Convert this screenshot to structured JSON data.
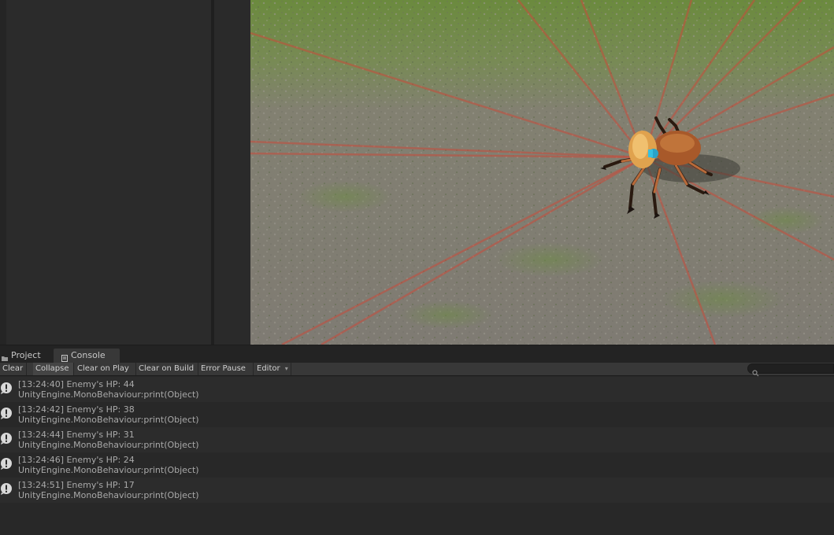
{
  "tabs": {
    "project_label": "Project",
    "console_label": "Console"
  },
  "toolbar": {
    "clear": "Clear",
    "collapse": "Collapse",
    "clear_on_play": "Clear on Play",
    "clear_on_build": "Clear on Build",
    "error_pause": "Error Pause",
    "editor": "Editor",
    "editor_arrow": "▾",
    "search_value": ""
  },
  "console": {
    "entries": [
      {
        "line1": "[13:24:40] Enemy's HP: 44",
        "line2": "UnityEngine.MonoBehaviour:print(Object)"
      },
      {
        "line1": "[13:24:42] Enemy's HP: 38",
        "line2": "UnityEngine.MonoBehaviour:print(Object)"
      },
      {
        "line1": "[13:24:44] Enemy's HP: 31",
        "line2": "UnityEngine.MonoBehaviour:print(Object)"
      },
      {
        "line1": "[13:24:46] Enemy's HP: 24",
        "line2": "UnityEngine.MonoBehaviour:print(Object)"
      },
      {
        "line1": "[13:24:51] Enemy's HP: 17",
        "line2": "UnityEngine.MonoBehaviour:print(Object)"
      }
    ]
  },
  "icons": {
    "project_tab": "folder-icon",
    "console_tab": "console-icon",
    "log_entry": "info-message-icon",
    "search": "search-icon"
  },
  "colors": {
    "editor_bg": "#282828",
    "toolbar_bg": "#383838",
    "log_text": "#a9a9a9",
    "ray_red": "#c94a3a"
  }
}
